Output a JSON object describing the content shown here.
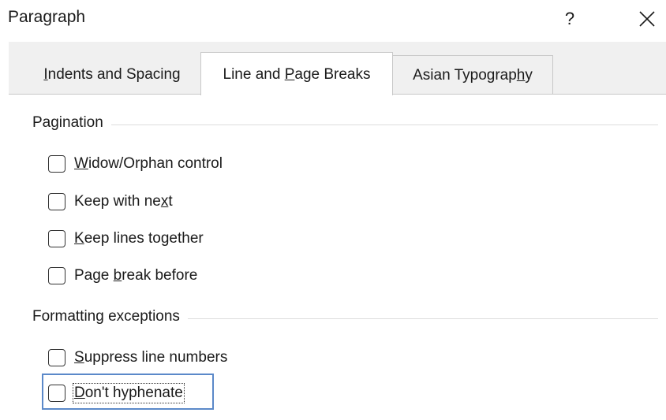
{
  "window": {
    "title": "Paragraph",
    "help_label": "?",
    "close_icon": "close-icon"
  },
  "tabs": [
    {
      "label_pre": "",
      "label_key": "I",
      "label_post": "ndents and Spacing",
      "selected": false
    },
    {
      "label_pre": "Line and ",
      "label_key": "P",
      "label_post": "age Breaks",
      "selected": true
    },
    {
      "label_pre": "Asian Typograp",
      "label_key": "h",
      "label_post": "y",
      "selected": false
    }
  ],
  "pagination": {
    "heading": "Pagination",
    "options": [
      {
        "pre": "",
        "key": "W",
        "post": "idow/Orphan control",
        "checked": false
      },
      {
        "pre": "Keep with ne",
        "key": "x",
        "post": "t",
        "checked": false
      },
      {
        "pre": "",
        "key": "K",
        "post": "eep lines together",
        "checked": false
      },
      {
        "pre": "Page ",
        "key": "b",
        "post": "reak before",
        "checked": false
      }
    ]
  },
  "formatting": {
    "heading": "Formatting exceptions",
    "options": [
      {
        "pre": "",
        "key": "S",
        "post": "uppress line numbers",
        "checked": false
      },
      {
        "pre": "",
        "key": "D",
        "post": "on't hyphenate",
        "checked": false,
        "focused": true
      }
    ]
  },
  "colors": {
    "dialog_bg": "#f0f0f0",
    "panel_bg": "#ffffff",
    "focus_ring": "#5b89c9"
  }
}
